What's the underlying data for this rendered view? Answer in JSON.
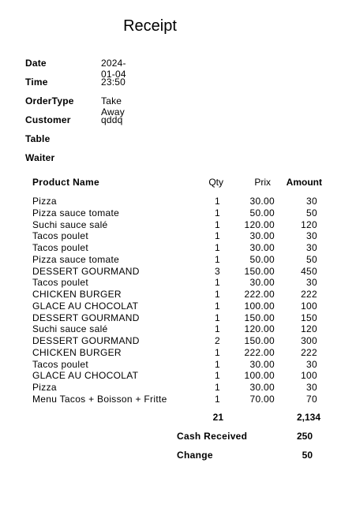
{
  "receipt": {
    "title": "Receipt",
    "info": [
      {
        "label": "Date",
        "value": "2024-01-04"
      },
      {
        "label": "Time",
        "value": "23:50"
      },
      {
        "label": "OrderType",
        "value": "Take Away"
      },
      {
        "label": "Customer",
        "value": "qddq"
      },
      {
        "label": "Table",
        "value": ""
      },
      {
        "label": "Waiter",
        "value": ""
      }
    ],
    "columns": {
      "name": "Product Name",
      "qty": "Qty",
      "prix": "Prix",
      "amount": "Amount"
    },
    "items": [
      {
        "name": "Pizza",
        "qty": "1",
        "prix": "30.00",
        "amount": "30"
      },
      {
        "name": "Pizza sauce tomate",
        "qty": "1",
        "prix": "50.00",
        "amount": "50"
      },
      {
        "name": "Suchi sauce salé",
        "qty": "1",
        "prix": "120.00",
        "amount": "120"
      },
      {
        "name": "Tacos poulet",
        "qty": "1",
        "prix": "30.00",
        "amount": "30"
      },
      {
        "name": "Tacos poulet",
        "qty": "1",
        "prix": "30.00",
        "amount": "30"
      },
      {
        "name": "Pizza sauce tomate",
        "qty": "1",
        "prix": "50.00",
        "amount": "50"
      },
      {
        "name": "DESSERT GOURMAND",
        "qty": "3",
        "prix": "150.00",
        "amount": "450"
      },
      {
        "name": "Tacos poulet",
        "qty": "1",
        "prix": "30.00",
        "amount": "30"
      },
      {
        "name": "CHICKEN BURGER",
        "qty": "1",
        "prix": "222.00",
        "amount": "222"
      },
      {
        "name": "GLACE AU CHOCOLAT",
        "qty": "1",
        "prix": "100.00",
        "amount": "100"
      },
      {
        "name": "DESSERT GOURMAND",
        "qty": "1",
        "prix": "150.00",
        "amount": "150"
      },
      {
        "name": "Suchi sauce salé",
        "qty": "1",
        "prix": "120.00",
        "amount": "120"
      },
      {
        "name": "DESSERT GOURMAND",
        "qty": "2",
        "prix": "150.00",
        "amount": "300"
      },
      {
        "name": "CHICKEN BURGER",
        "qty": "1",
        "prix": "222.00",
        "amount": "222"
      },
      {
        "name": "Tacos poulet",
        "qty": "1",
        "prix": "30.00",
        "amount": "30"
      },
      {
        "name": "GLACE AU CHOCOLAT",
        "qty": "1",
        "prix": "100.00",
        "amount": "100"
      },
      {
        "name": "Pizza",
        "qty": "1",
        "prix": "30.00",
        "amount": "30"
      },
      {
        "name": "Menu Tacos + Boisson + Fritte",
        "qty": "1",
        "prix": "70.00",
        "amount": "70"
      }
    ],
    "totals": {
      "qty": "21",
      "amount": "2,134"
    },
    "cash_received": {
      "label": "Cash Received",
      "value": "250"
    },
    "change": {
      "label": "Change",
      "value": "50"
    }
  }
}
